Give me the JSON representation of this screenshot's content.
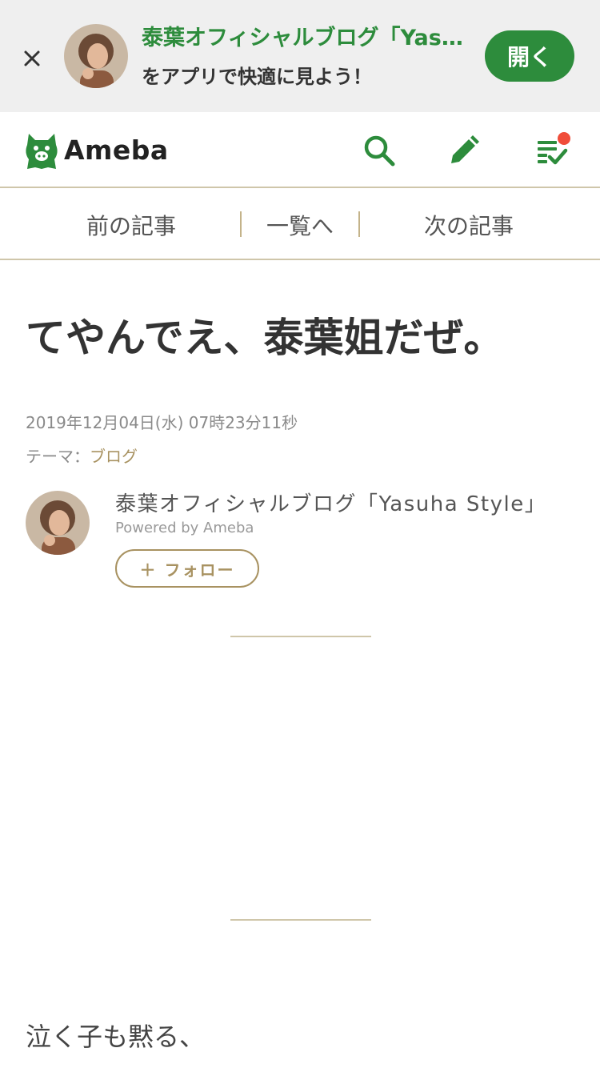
{
  "app_banner": {
    "title": "泰葉オフィシャルブログ「Yasuha Style」",
    "subtitle": "をアプリで快適に見よう！",
    "open_label": "開く",
    "close_icon": "close-icon"
  },
  "header": {
    "logo_text": "Ameba",
    "icons": [
      "search-icon",
      "pencil-icon",
      "reading-list-icon"
    ],
    "accent_color": "#2d8c3c",
    "notification_color": "#f04d3a"
  },
  "article_nav": {
    "prev": "前の記事",
    "list": "一覧へ",
    "next": "次の記事"
  },
  "article": {
    "title": "てやんでえ、泰葉姐だぜ。",
    "date": "2019年12月04日(水) 07時23分11秒",
    "theme_label": "テーマ：",
    "theme_value": "ブログ",
    "body_first_line": "泣く子も黙る、"
  },
  "author": {
    "name": "泰葉オフィシャルブログ「Yasuha Style」",
    "powered_by": "Powered by Ameba",
    "follow_label": "＋ フォロー"
  }
}
